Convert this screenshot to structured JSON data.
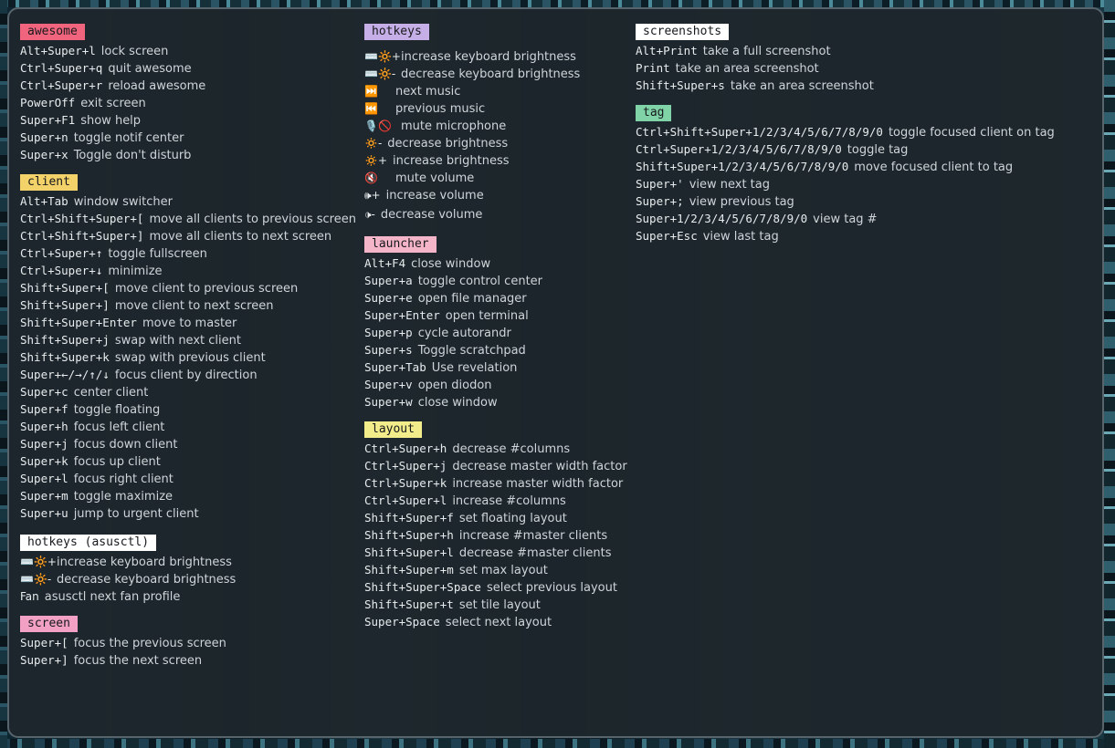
{
  "colors": {
    "awesome": "#f0657d",
    "client": "#f3d26a",
    "hotkeys_asusctl": "#ffffff",
    "screen": "#f2a1c4",
    "hotkeys": "#c6aee6",
    "launcher": "#f5b5c8",
    "layout": "#f3ec8a",
    "screenshots": "#ffffff",
    "tag": "#7fd3a6"
  },
  "awesome": {
    "title": "awesome",
    "rows": [
      {
        "key": "Alt+Super+l",
        "desc": "lock screen"
      },
      {
        "key": "Ctrl+Super+q",
        "desc": "quit awesome"
      },
      {
        "key": "Ctrl+Super+r",
        "desc": "reload awesome"
      },
      {
        "key": "PowerOff",
        "desc": "exit screen"
      },
      {
        "key": "Super+F1",
        "desc": "show help"
      },
      {
        "key": "Super+n",
        "desc": "toggle notif center"
      },
      {
        "key": "Super+x",
        "desc": "Toggle don't disturb"
      }
    ]
  },
  "client": {
    "title": "client",
    "rows": [
      {
        "key": "Alt+Tab",
        "desc": "window switcher"
      },
      {
        "key": "Ctrl+Shift+Super+[",
        "desc": "move all clients to previous screen"
      },
      {
        "key": "Ctrl+Shift+Super+]",
        "desc": "move all clients to next screen"
      },
      {
        "key": "Ctrl+Super+↑",
        "desc": "toggle fullscreen"
      },
      {
        "key": "Ctrl+Super+↓",
        "desc": "minimize"
      },
      {
        "key": "Shift+Super+[",
        "desc": "move client to previous screen"
      },
      {
        "key": "Shift+Super+]",
        "desc": "move client to next screen"
      },
      {
        "key": "Shift+Super+Enter",
        "desc": "move to master"
      },
      {
        "key": "Shift+Super+j",
        "desc": "swap with next client"
      },
      {
        "key": "Shift+Super+k",
        "desc": "swap with previous client"
      },
      {
        "key": "Super+←/→/↑/↓",
        "desc": "focus client by direction"
      },
      {
        "key": "Super+c",
        "desc": "center client"
      },
      {
        "key": "Super+f",
        "desc": "toggle floating"
      },
      {
        "key": "Super+h",
        "desc": "focus left client"
      },
      {
        "key": "Super+j",
        "desc": "focus down client"
      },
      {
        "key": "Super+k",
        "desc": "focus up client"
      },
      {
        "key": "Super+l",
        "desc": "focus right client"
      },
      {
        "key": "Super+m",
        "desc": "toggle maximize"
      },
      {
        "key": "Super+u",
        "desc": "jump to urgent client"
      }
    ]
  },
  "hotkeys_asusctl": {
    "title": "hotkeys (asusctl)",
    "rows": [
      {
        "key": "⌨️🔆+",
        "desc": "increase keyboard brightness"
      },
      {
        "key": "⌨️🔆-",
        "desc": "decrease keyboard brightness"
      },
      {
        "key": "Fan",
        "desc": "asusctl next fan profile"
      }
    ]
  },
  "screen": {
    "title": "screen",
    "rows": [
      {
        "key": "Super+[",
        "desc": "focus the previous screen"
      },
      {
        "key": "Super+]",
        "desc": "focus the next screen"
      }
    ]
  },
  "hotkeys": {
    "title": "hotkeys",
    "rows": [
      {
        "key": "⌨️🔆+",
        "desc": "increase keyboard brightness"
      },
      {
        "key": "⌨️🔆-",
        "desc": "decrease keyboard brightness"
      },
      {
        "key": "⏭️",
        "desc": "next music"
      },
      {
        "key": "⏮️",
        "desc": "previous music"
      },
      {
        "key": "🎙️🚫",
        "desc": "mute microphone"
      },
      {
        "key": "🔅-",
        "desc": "decrease brightness"
      },
      {
        "key": "🔅+",
        "desc": "increase brightness"
      },
      {
        "key": "🔇",
        "desc": "mute volume"
      },
      {
        "key": "🕪+",
        "desc": "increase volume"
      },
      {
        "key": "🕩-",
        "desc": "decrease volume"
      }
    ]
  },
  "launcher": {
    "title": "launcher",
    "rows": [
      {
        "key": "Alt+F4",
        "desc": "close window"
      },
      {
        "key": "Super+a",
        "desc": "toggle control center"
      },
      {
        "key": "Super+e",
        "desc": "open file manager"
      },
      {
        "key": "Super+Enter",
        "desc": "open terminal"
      },
      {
        "key": "Super+p",
        "desc": "cycle autorandr"
      },
      {
        "key": "Super+s",
        "desc": "Toggle scratchpad"
      },
      {
        "key": "Super+Tab",
        "desc": "Use revelation"
      },
      {
        "key": "Super+v",
        "desc": "open diodon"
      },
      {
        "key": "Super+w",
        "desc": "close window"
      }
    ]
  },
  "layout": {
    "title": "layout",
    "rows": [
      {
        "key": "Ctrl+Super+h",
        "desc": "decrease #columns"
      },
      {
        "key": "Ctrl+Super+j",
        "desc": "decrease master width factor"
      },
      {
        "key": "Ctrl+Super+k",
        "desc": "increase master width factor"
      },
      {
        "key": "Ctrl+Super+l",
        "desc": "increase #columns"
      },
      {
        "key": "Shift+Super+f",
        "desc": "set floating layout"
      },
      {
        "key": "Shift+Super+h",
        "desc": "increase #master clients"
      },
      {
        "key": "Shift+Super+l",
        "desc": "decrease #master clients"
      },
      {
        "key": "Shift+Super+m",
        "desc": "set max layout"
      },
      {
        "key": "Shift+Super+Space",
        "desc": "select previous layout"
      },
      {
        "key": "Shift+Super+t",
        "desc": "set tile layout"
      },
      {
        "key": "Super+Space",
        "desc": "select next layout"
      }
    ]
  },
  "screenshots": {
    "title": "screenshots",
    "rows": [
      {
        "key": "Alt+Print",
        "desc": "take a full screenshot"
      },
      {
        "key": "Print",
        "desc": "take an area screenshot"
      },
      {
        "key": "Shift+Super+s",
        "desc": "take an area screenshot"
      }
    ]
  },
  "tag": {
    "title": "tag",
    "rows": [
      {
        "key": "Ctrl+Shift+Super+1/2/3/4/5/6/7/8/9/0",
        "desc": "toggle focused client on tag"
      },
      {
        "key": "Ctrl+Super+1/2/3/4/5/6/7/8/9/0",
        "desc": "toggle tag"
      },
      {
        "key": "Shift+Super+1/2/3/4/5/6/7/8/9/0",
        "desc": "move focused client to tag"
      },
      {
        "key": "Super+'",
        "desc": "view next tag"
      },
      {
        "key": "Super+;",
        "desc": "view previous tag"
      },
      {
        "key": "Super+1/2/3/4/5/6/7/8/9/0",
        "desc": "view tag #"
      },
      {
        "key": "Super+Esc",
        "desc": "view last tag"
      }
    ]
  }
}
